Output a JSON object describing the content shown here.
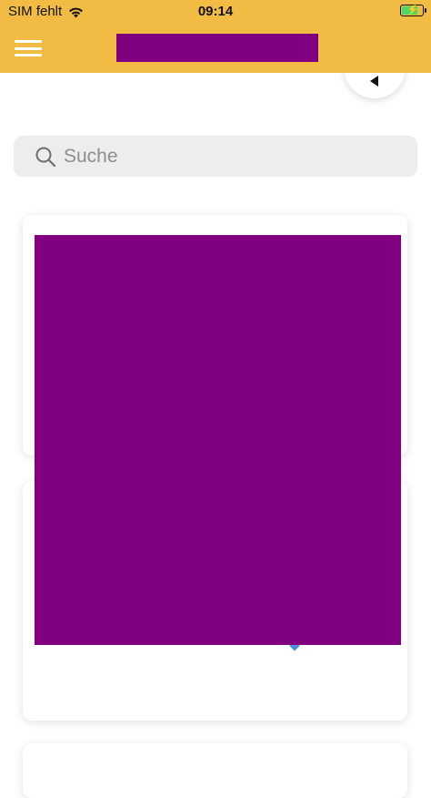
{
  "status_bar": {
    "carrier": "SIM fehlt",
    "time": "09:14"
  },
  "header": {
    "menu_icon": "hamburger-menu-icon",
    "background_color": "#f2bc44",
    "logo_block_color": "#800080"
  },
  "search": {
    "placeholder": "Suche",
    "icon": "search-icon"
  },
  "colors": {
    "accent": "#800080",
    "status_battery": "#4cd964",
    "indicator": "#4a90e2"
  }
}
